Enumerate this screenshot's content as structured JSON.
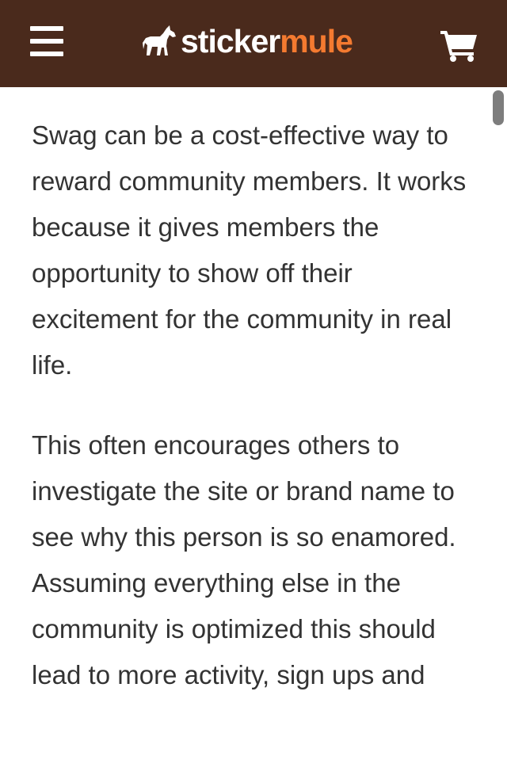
{
  "header": {
    "logo_text_1": "sticker",
    "logo_text_2": "mule",
    "menu_icon": "hamburger-menu-icon",
    "cart_icon": "shopping-cart-icon",
    "logo_icon": "mule-logo-icon"
  },
  "article": {
    "paragraphs": [
      "Swag can be a cost-effective way to reward community members. It works because it gives members the opportunity to show off their excitement for the community in real life.",
      "This often encourages others to investigate the site or brand name to see why this person is so enamored. Assuming everything else in the community is optimized this should lead to more activity, sign ups and"
    ]
  },
  "colors": {
    "header_bg": "#4a2a1c",
    "accent": "#f47a30",
    "text": "#333333"
  }
}
